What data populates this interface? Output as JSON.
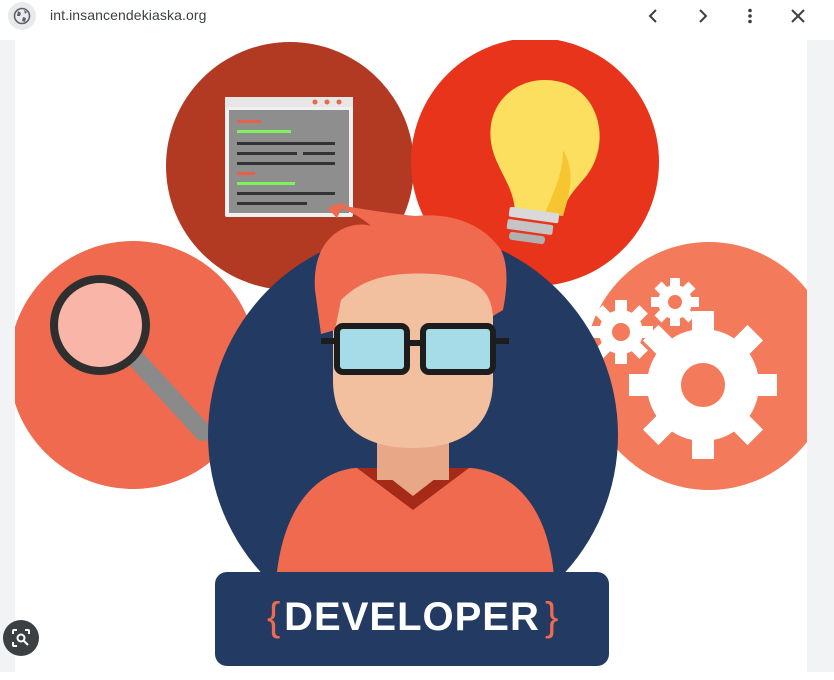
{
  "toolbar": {
    "site_icon": "globe-icon",
    "url": "int.insancendekiaska.org",
    "prev_icon": "chevron-left-icon",
    "next_icon": "chevron-right-icon",
    "more_icon": "more-vertical-icon",
    "close_icon": "close-icon"
  },
  "image": {
    "badge_text": "DEVELOPER",
    "brace_open": "{",
    "brace_close": "}"
  },
  "lens": {
    "icon": "lens-search-icon"
  },
  "colors": {
    "navy": "#233a63",
    "coral": "#ef6a4f",
    "brick": "#b23a23",
    "red": "#e8341b",
    "salmon": "#f37a5a",
    "skin": "#f2c09e",
    "glasses": "#a6dbe8",
    "bulb": "#fddf5f"
  }
}
